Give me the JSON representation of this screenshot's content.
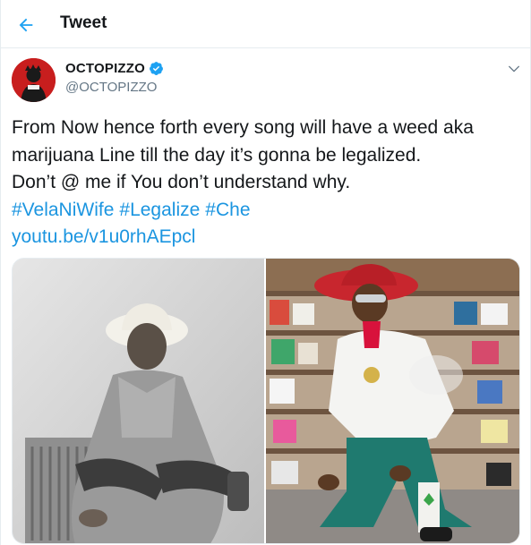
{
  "header": {
    "title": "Tweet"
  },
  "author": {
    "display_name": "OCTOPIZZO",
    "handle": "@OCTOPIZZO",
    "verified": true
  },
  "tweet": {
    "text_line1": "From Now hence forth every song will have a weed aka",
    "text_line2": "marijuana Line till the day it’s gonna be legalized.",
    "text_line3": "Don’t @ me if You don’t understand why.",
    "hashtags": [
      "#VelaNiWife",
      "#Legalize",
      "#Che"
    ],
    "link": "youtu.be/v1u0rhAEpcl"
  },
  "media": {
    "photos": [
      "photo-black-and-white-man-in-hat",
      "photo-man-in-red-hat-smoking"
    ]
  },
  "colors": {
    "accent": "#1da1f2",
    "link": "#1b95e0",
    "muted": "#657786"
  }
}
